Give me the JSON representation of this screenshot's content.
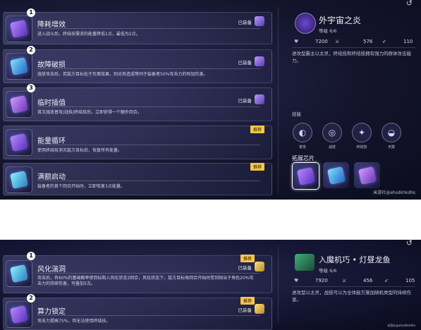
{
  "panel1": {
    "cards": [
      {
        "num": "1",
        "title": "降耗增效",
        "desc": "进入战斗后，终结技需求的能量降低1点，最低为2点。",
        "status": "已装备",
        "tag": "",
        "chip": "purple"
      },
      {
        "num": "2",
        "title": "故障破损",
        "desc": "施放攻击后，若敌方目标处于负面效果，则对其造成等同于装备者50%攻击力的附加伤害。",
        "status": "已装备",
        "tag": "",
        "chip": "blue"
      },
      {
        "num": "3",
        "title": "临时插值",
        "desc": "首次施放普攻/战技/终结技后，立即获得一个额外回合。",
        "status": "已装备",
        "tag": "",
        "chip": "violet"
      },
      {
        "num": "",
        "title": "能量循环",
        "desc": "使用终结技消灭敌方目标后，恢复所有能量。",
        "status": "",
        "tag": "推荐",
        "chip": "purple"
      },
      {
        "num": "",
        "title": "满额启动",
        "desc": "装备者的首个回合开始时，立即恢复3点能量。",
        "status": "",
        "tag": "推荐",
        "chip": "teal"
      }
    ],
    "right": {
      "name": "外宇宙之炎",
      "level": "等级 6/6",
      "stats": [
        "7200",
        "576",
        "110"
      ],
      "desc": "进攻型霸主以太灵，终结技和终结技拥有强力的群体攻击能力。",
      "skills_title": "技能",
      "skills": [
        {
          "label": "普攻",
          "icon": "◐"
        },
        {
          "label": "战技",
          "icon": "◎"
        },
        {
          "label": "终结技",
          "icon": "✦"
        },
        {
          "label": "天赋",
          "icon": "◒"
        }
      ],
      "expansion_title": "拓展芯片",
      "watermark": "米游社@ahsdkhkdhs"
    }
  },
  "panel2": {
    "cards": [
      {
        "num": "1",
        "title": "风化湍洞",
        "desc": "攻击后，有60%的基础概率使目标陷入风化状态2回合，风化状态下，敌方目标每回合开始时受到相当于角色20%攻击力的持续伤害，可叠加5次。",
        "status": "已装备",
        "tag": "推荐",
        "chip": "teal"
      },
      {
        "num": "2",
        "title": "算力锁定",
        "desc": "攻击力提高75%，但无法使用终结技。",
        "status": "已装备",
        "tag": "推荐",
        "chip": "purple"
      }
    ],
    "right": {
      "name": "入魔机巧 • 灯昼龙鱼",
      "level": "等级 6/6",
      "stats": [
        "7920",
        "456",
        "105"
      ],
      "desc": "进攻型以太灵，战技可以为全体敌方施加随机类型的持续伤害。",
      "watermark": "米游社@ahsdkhkdhs"
    }
  }
}
